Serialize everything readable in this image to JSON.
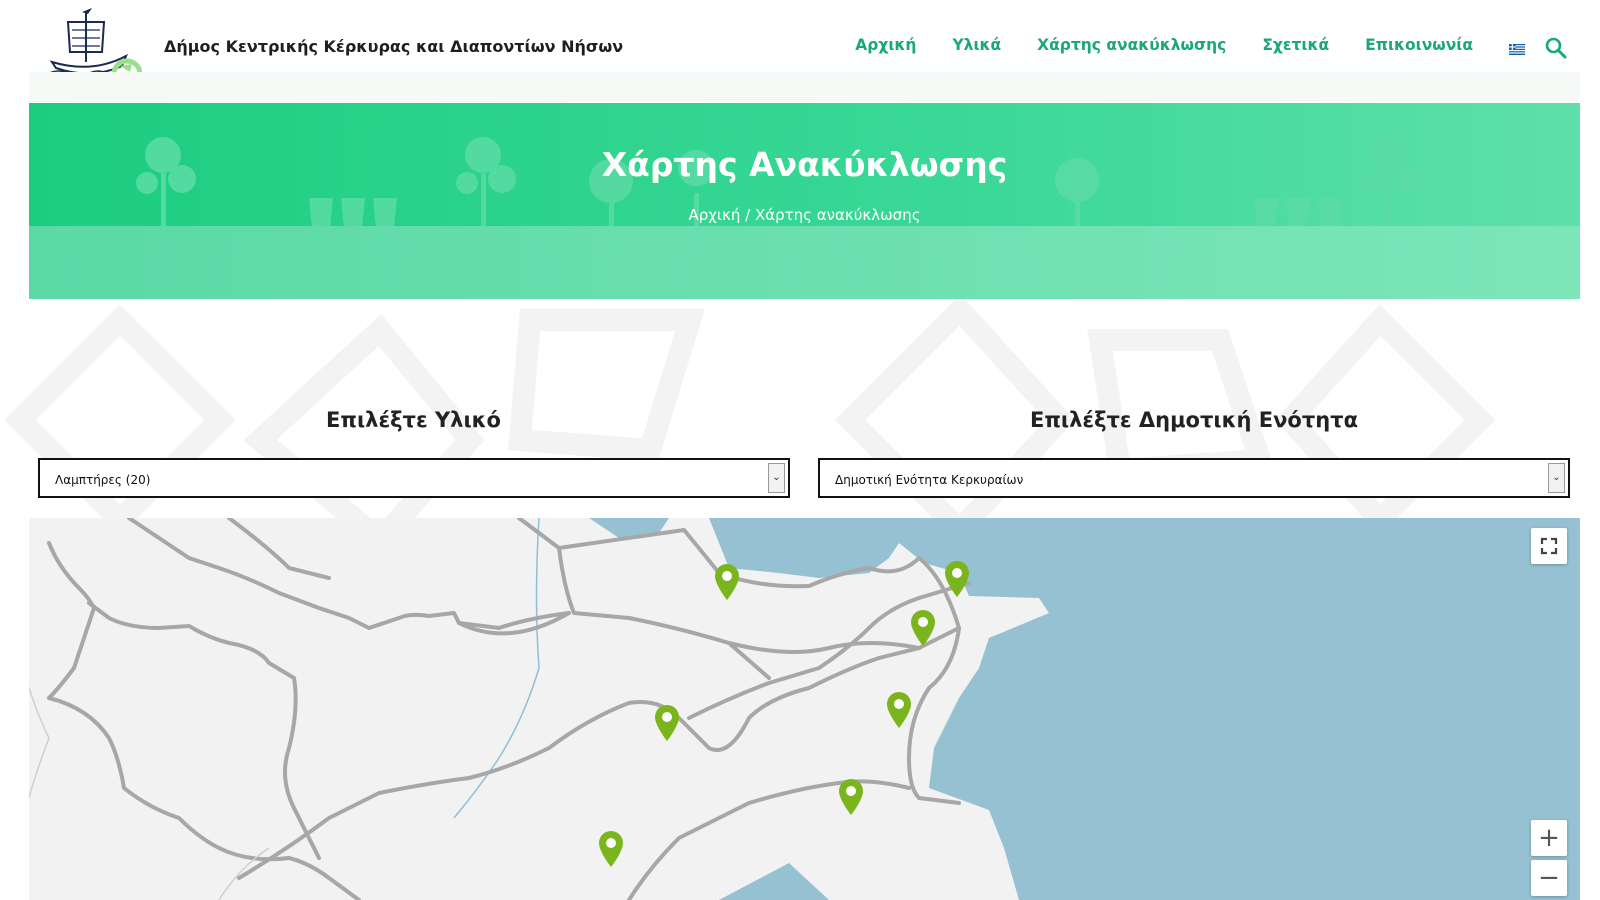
{
  "header": {
    "site_title": "Δήμος Κεντρικής Κέρκυρας και Διαποντίων Νήσων",
    "nav": [
      {
        "label": "Αρχική"
      },
      {
        "label": "Υλικά"
      },
      {
        "label": "Χάρτης ανακύκλωσης"
      },
      {
        "label": "Σχετικά"
      },
      {
        "label": "Επικοινωνία"
      }
    ]
  },
  "hero": {
    "title": "Χάρτης Ανακύκλωσης",
    "breadcrumb_home": "Αρχική",
    "breadcrumb_sep": " / ",
    "breadcrumb_current": "Χάρτης ανακύκλωσης"
  },
  "filters": {
    "material_label": "Επιλέξτε Υλικό",
    "material_value": "Λαμπτήρες (20)",
    "unit_label": "Επιλέξτε Δημοτική Ενότητα",
    "unit_value": "Δημοτική Ενότητα Κερκυραίων"
  },
  "map": {
    "fullscreen_symbol": "⛶",
    "zoom_in": "+",
    "zoom_out": "−",
    "marker_color": "#7ab51d",
    "water_color": "#96c1d2"
  },
  "colors": {
    "accent": "#1aa87a",
    "hero_start": "#1ccd80",
    "hero_end": "#5ee0aa"
  }
}
